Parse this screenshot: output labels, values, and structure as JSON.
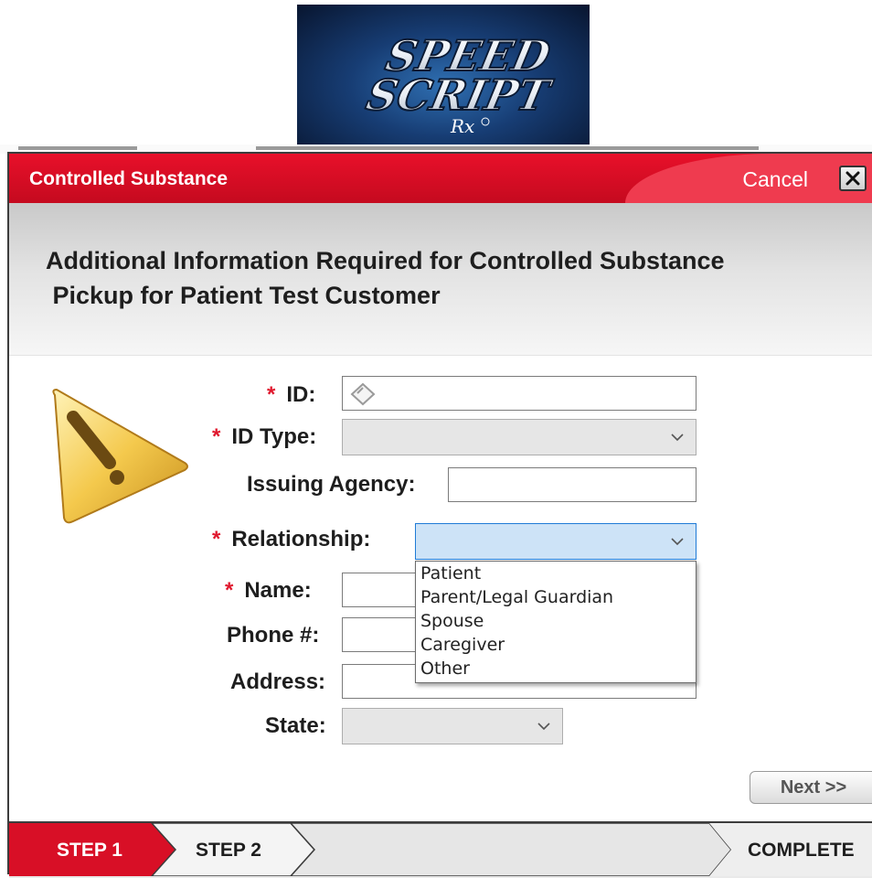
{
  "logo": {
    "line1": "SPEED",
    "line2": "SCRIPT",
    "mark": "Rx"
  },
  "dialog": {
    "title": "Controlled Substance",
    "cancel_label": "Cancel",
    "close_label": "X",
    "heading": "Additional Information Required for Controlled Substance\n Pickup for Patient Test Customer"
  },
  "form": {
    "required_mark": "*",
    "id_label": "ID:",
    "id_value": "",
    "id_type_label": "ID Type:",
    "id_type_value": "",
    "issuing_agency_label": "Issuing Agency:",
    "issuing_agency_value": "",
    "relationship_label": "Relationship:",
    "relationship_value": "",
    "name_label": "Name:",
    "phone_label": "Phone #:",
    "address_label": "Address:",
    "state_label": "State:",
    "state_value": ""
  },
  "relationship_options": [
    "Patient",
    "Parent/Legal Guardian",
    "Spouse",
    "Caregiver",
    "Other"
  ],
  "buttons": {
    "next_label": "Next >>"
  },
  "steps": {
    "step1": "STEP 1",
    "step2": "STEP 2",
    "complete": "COMPLETE",
    "active": "STEP 1"
  },
  "colors": {
    "accent_red": "#e0182e",
    "title_red": "#d40d24",
    "focus_blue": "#cde3f7"
  },
  "icons": {
    "warning": "warning-icon",
    "chevron": "chevron-down-icon",
    "close": "close-icon",
    "id_scan": "id-card-icon"
  }
}
